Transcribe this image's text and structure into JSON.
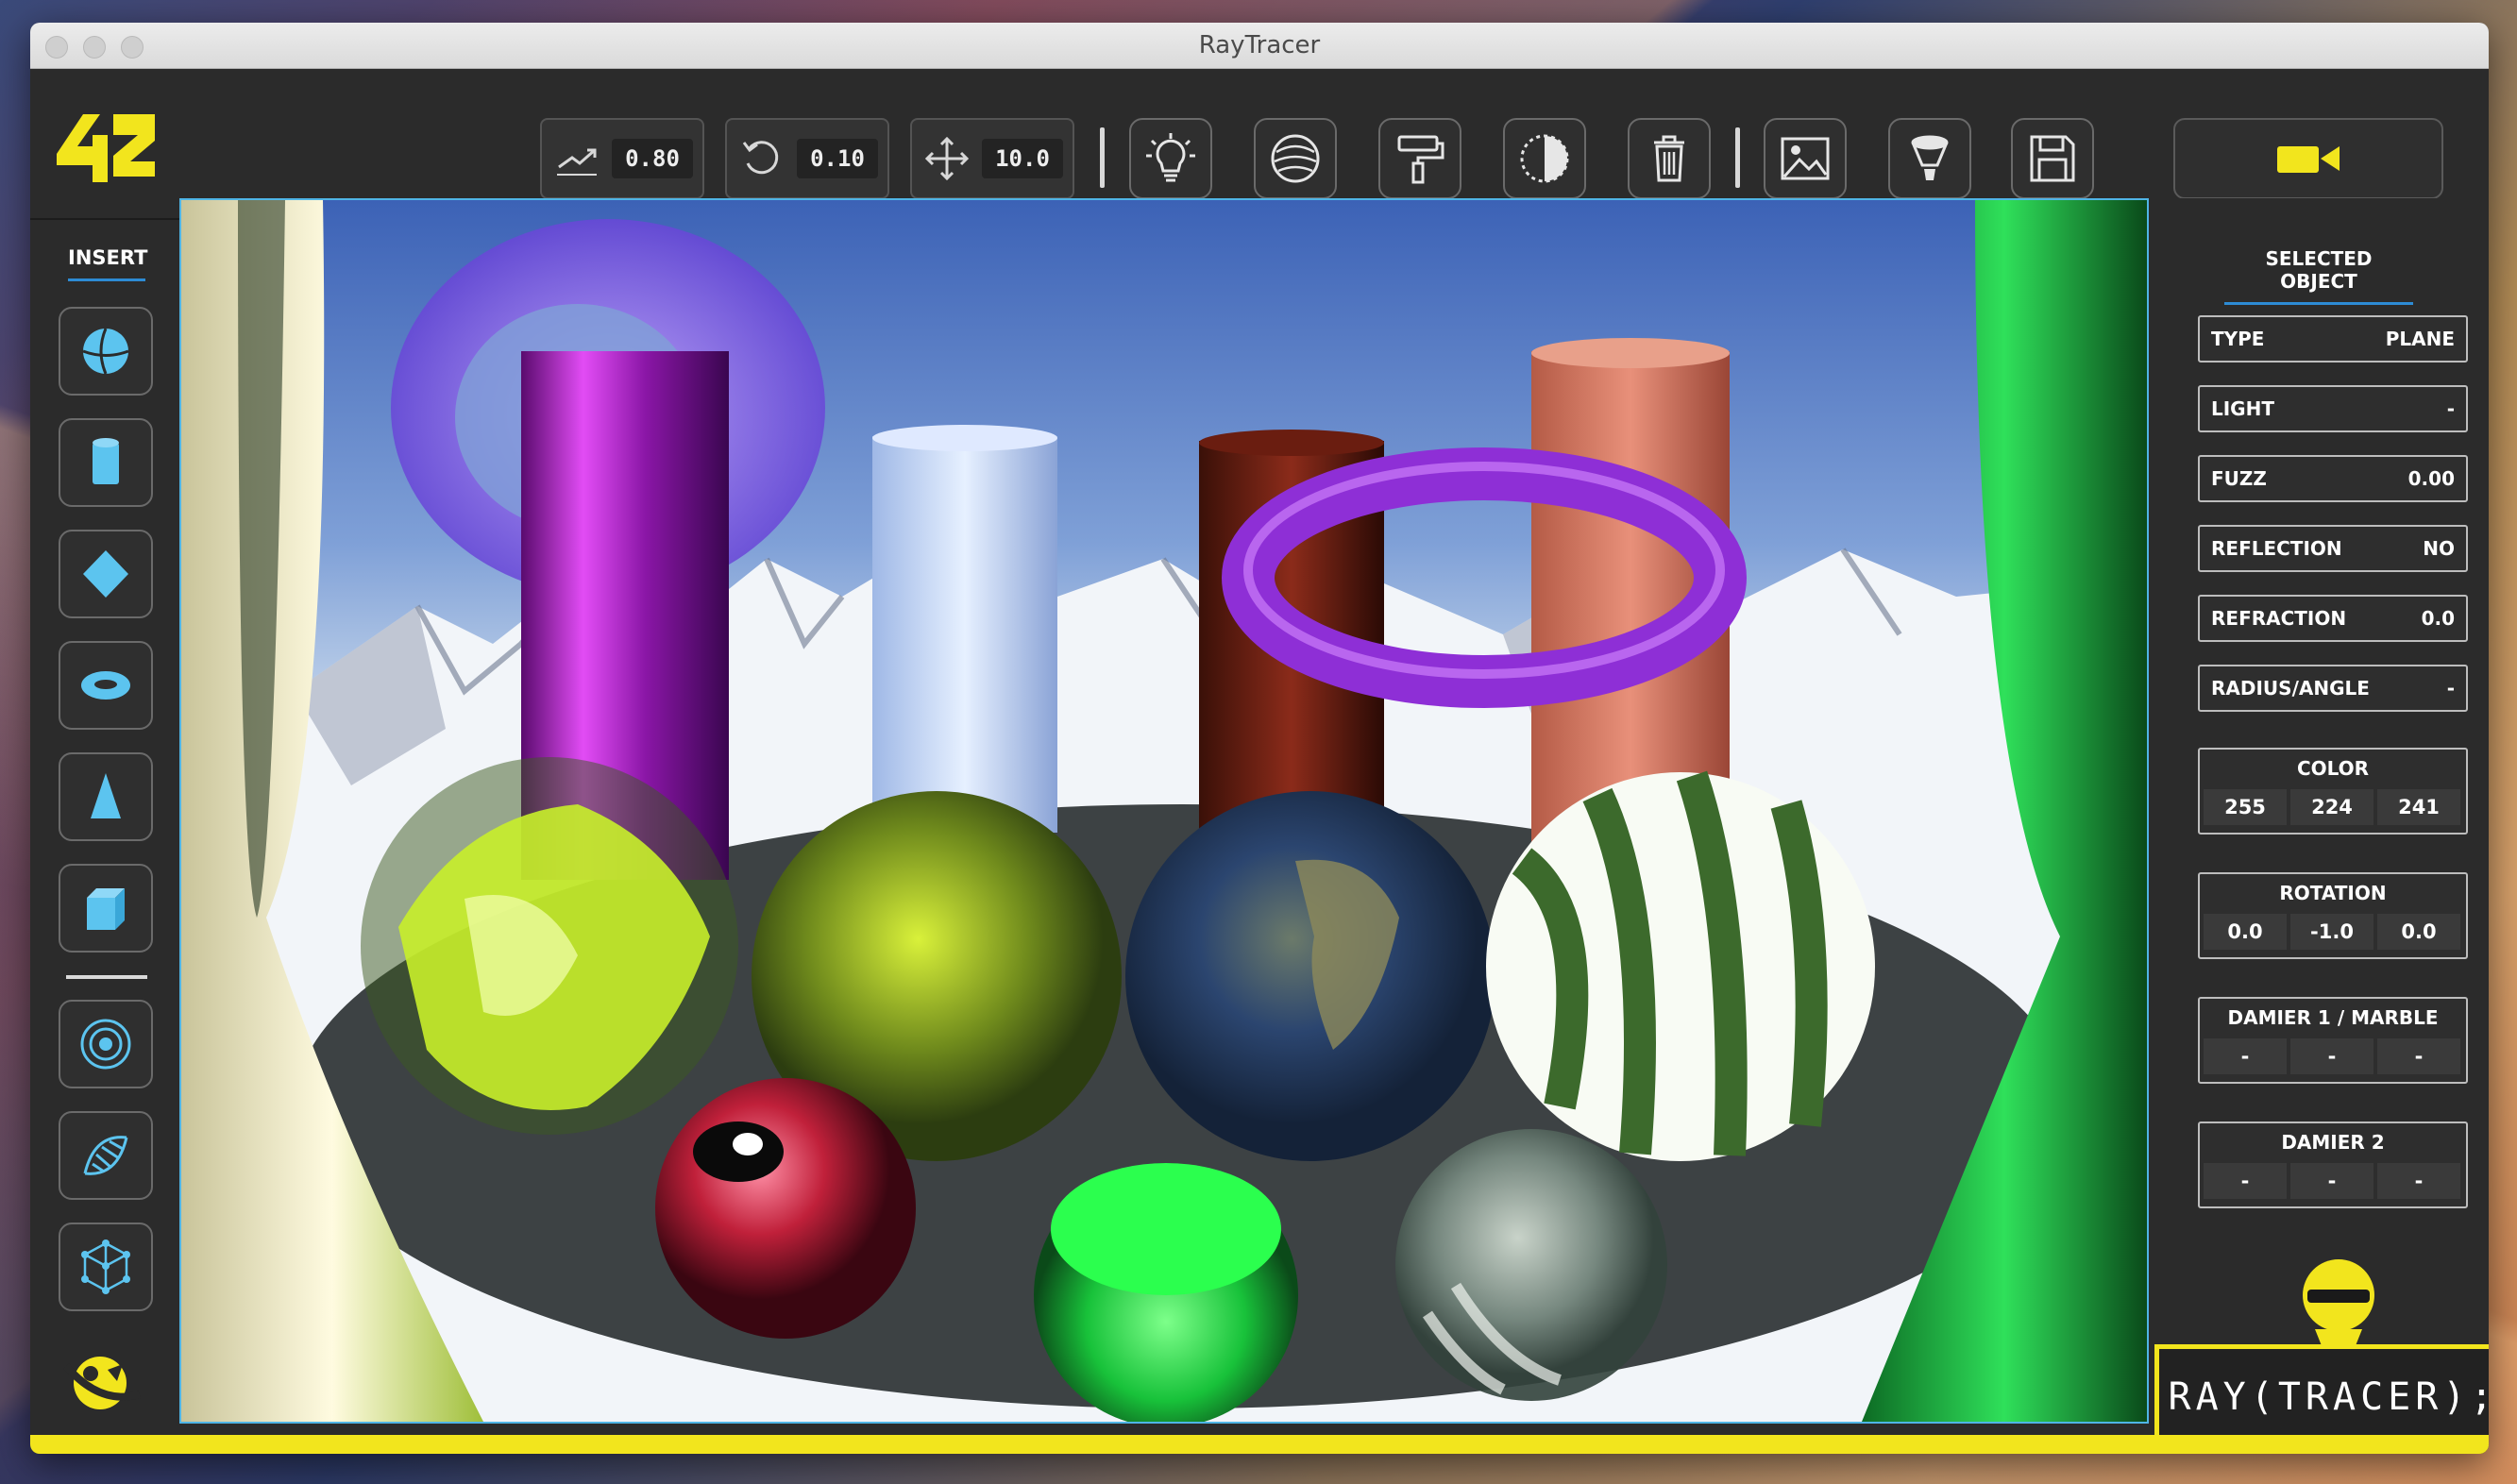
{
  "window": {
    "title": "RayTracer"
  },
  "toolbar": {
    "speed_value": "0.80",
    "rotation_value": "0.10",
    "move_value": "10.0",
    "buttons": [
      "light-bulb",
      "texture-sphere",
      "paint-roller",
      "contrast",
      "trash",
      "image",
      "filter",
      "save"
    ]
  },
  "sidebar": {
    "title": "INSERT",
    "items": [
      "sphere",
      "cylinder",
      "diamond",
      "torus",
      "cone",
      "cube",
      "target-rings",
      "dna-helix",
      "graph-cube"
    ]
  },
  "panel": {
    "title": "SELECTED OBJECT",
    "type_label": "TYPE",
    "type_value": "PLANE",
    "light_label": "LIGHT",
    "light_value": "-",
    "fuzz_label": "FUZZ",
    "fuzz_value": "0.00",
    "reflection_label": "REFLECTION",
    "reflection_value": "NO",
    "refraction_label": "REFRACTION",
    "refraction_value": "0.0",
    "radius_label": "RADIUS/ANGLE",
    "radius_value": "-",
    "color": {
      "label": "COLOR",
      "r": "255",
      "g": "224",
      "b": "241"
    },
    "rotation": {
      "label": "ROTATION",
      "x": "0.0",
      "y": "-1.0",
      "z": "0.0"
    },
    "damier1": {
      "label": "DAMIER 1 / MARBLE",
      "a": "-",
      "b": "-",
      "c": "-"
    },
    "damier2": {
      "label": "DAMIER 2",
      "a": "-",
      "b": "-",
      "c": "-"
    }
  },
  "brand": {
    "text": "RAY(TRACER);"
  },
  "colors": {
    "accent": "#f2e51d",
    "selection": "#4fb5e6",
    "panel": "#2b2b2b"
  }
}
